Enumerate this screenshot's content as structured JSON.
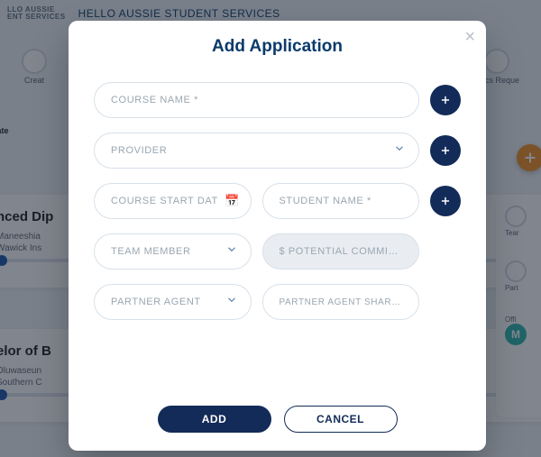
{
  "header": {
    "brand_line1": "LLO AUSSIE",
    "brand_line2": "ENT SERVICES",
    "title": "HELLO AUSSIE STUDENT SERVICES"
  },
  "steps": {
    "left_label": "Creat",
    "right_label": "Docs Reque"
  },
  "bg": {
    "row_label": "n Date",
    "card1_title": "nced Dip",
    "card1_l1": "Maneeshia",
    "card1_l2": "Wawick Ins",
    "card2_title": "elor of B",
    "card2_l1": "Oluwaseun",
    "card2_l2": "Southern C",
    "rp_team": "Tear",
    "rp_part": "Part",
    "rp_offi": "Offi",
    "rp_avatar": "M"
  },
  "modal": {
    "title": "Add Application",
    "close": "×",
    "fields": {
      "course_name": "COURSE NAME *",
      "provider": "PROVIDER",
      "course_start": "COURSE START DAT",
      "student_name": "STUDENT NAME *",
      "team_member": "TEAM MEMBER",
      "potential_commission": "$ POTENTIAL COMMISSIO",
      "partner_agent": "PARTNER AGENT",
      "partner_share": "PARTNER AGENT SHARE*%"
    },
    "actions": {
      "add": "ADD",
      "cancel": "CANCEL"
    }
  }
}
